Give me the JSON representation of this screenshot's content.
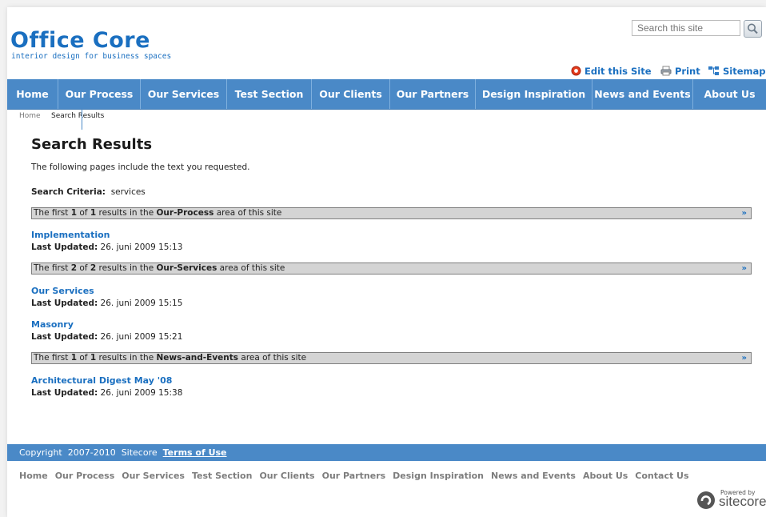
{
  "header": {
    "logo_title": "Office Core",
    "logo_tagline": "interior design for business spaces",
    "search_placeholder": "Search this site",
    "edit_label": "Edit this Site",
    "print_label": "Print",
    "sitemap_label": "Sitemap"
  },
  "nav": [
    "Home",
    "Our Process",
    "Our Services",
    "Test Section",
    "Our Clients",
    "Our Partners",
    "Design Inspiration",
    "News and Events",
    "About Us"
  ],
  "breadcrumb": {
    "home": "Home",
    "current": "Search Results"
  },
  "main": {
    "heading": "Search Results",
    "intro": "The following pages include the text you requested.",
    "criteria_label": "Search Criteria:",
    "criteria_value": "services",
    "more_glyph": "»",
    "sections": [
      {
        "prefix": "The first ",
        "shown": "1",
        "of": " of ",
        "total": "1",
        "mid": " results in the ",
        "area": "Our-Process",
        "suffix": " area of this site",
        "results": [
          {
            "title": "Implementation",
            "meta_label": "Last Updated:",
            "meta_value": "26. juni 2009 15:13"
          }
        ]
      },
      {
        "prefix": "The first ",
        "shown": "2",
        "of": " of ",
        "total": "2",
        "mid": " results in the ",
        "area": "Our-Services",
        "suffix": " area of this site",
        "results": [
          {
            "title": "Our Services",
            "meta_label": "Last Updated:",
            "meta_value": "26. juni 2009 15:15"
          },
          {
            "title": "Masonry",
            "meta_label": "Last Updated:",
            "meta_value": "26. juni 2009 15:21"
          }
        ]
      },
      {
        "prefix": "The first ",
        "shown": "1",
        "of": " of ",
        "total": "1",
        "mid": " results in the ",
        "area": "News-and-Events",
        "suffix": " area of this site",
        "results": [
          {
            "title": "Architectural Digest May '08",
            "meta_label": "Last Updated:",
            "meta_value": "26. juni 2009 15:38"
          }
        ]
      }
    ]
  },
  "footer": {
    "copyright": "Copyright  2007-2010  Sitecore  ",
    "terms": "Terms of Use",
    "links": [
      "Home",
      "Our Process",
      "Our Services",
      "Test Section",
      "Our Clients",
      "Our Partners",
      "Design Inspiration",
      "News and Events",
      "About Us",
      "Contact Us"
    ],
    "powered_by": "Powered by",
    "powered_name": "sitecore"
  },
  "colors": {
    "brand_blue": "#1a6fc0",
    "nav_blue": "#4a89c7",
    "section_bar": "#d4d4d4"
  }
}
